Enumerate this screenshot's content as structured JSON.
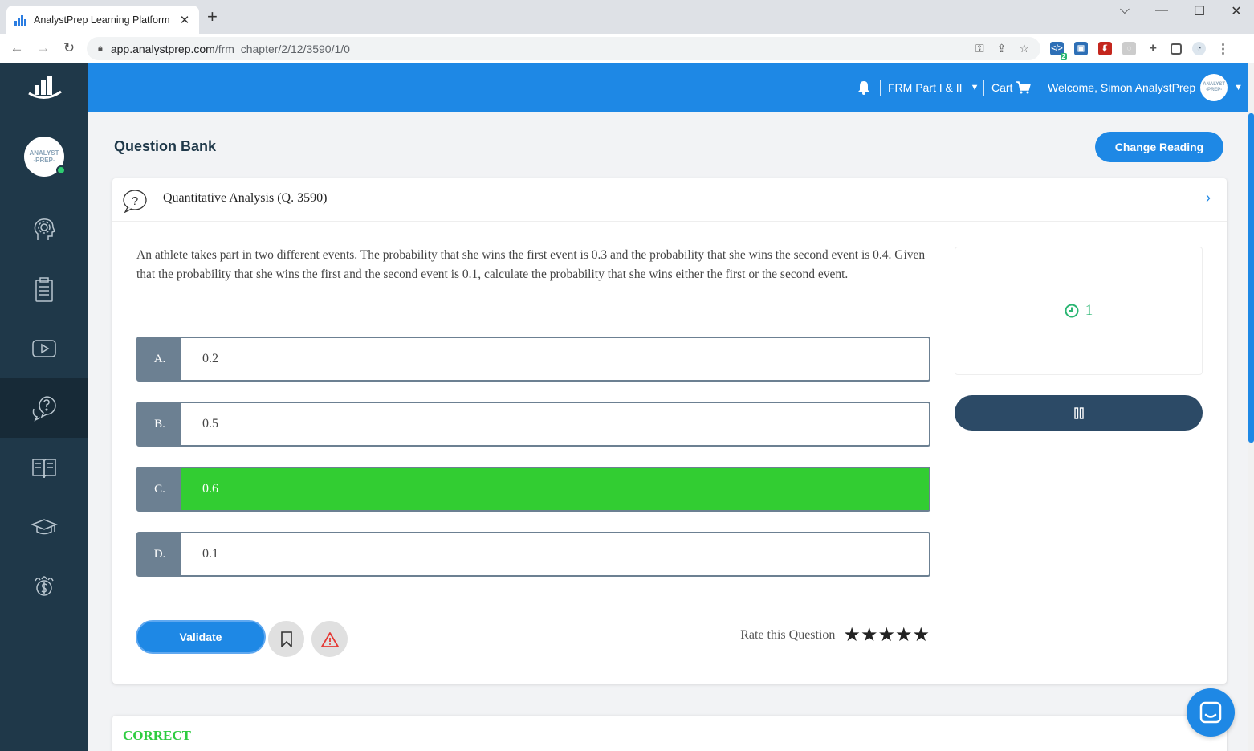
{
  "browser": {
    "tab_title": "AnalystPrep Learning Platform",
    "url_host": "app.analystprep.com",
    "url_path": "/frm_chapter/2/12/3590/1/0",
    "ext_badge": "2"
  },
  "header": {
    "course": "FRM Part I & II",
    "cart": "Cart",
    "welcome": "Welcome, Simon AnalystPrep",
    "avatar_line1": "ANALYST",
    "avatar_line2": "-PREP-"
  },
  "sidebar": {
    "avatar_line1": "ANALYST",
    "avatar_line2": "-PREP-",
    "items": [
      "settings",
      "notes",
      "videos",
      "question-bank",
      "reading",
      "courses",
      "finance"
    ],
    "active": "question-bank"
  },
  "page": {
    "title": "Question Bank",
    "change_reading": "Change Reading"
  },
  "question": {
    "title": "Quantitative Analysis (Q. 3590)",
    "text": "An athlete takes part in two different events. The probability that she wins the first event is 0.3 and the probability that she wins the second event is 0.4. Given that the probability that she wins the first and the second event is 0.1, calculate the probability that she wins either the first or the second event.",
    "options": [
      {
        "letter": "A.",
        "value": "0.2"
      },
      {
        "letter": "B.",
        "value": "0.5"
      },
      {
        "letter": "C.",
        "value": "0.6"
      },
      {
        "letter": "D.",
        "value": "0.1"
      }
    ],
    "correct_index": 2,
    "validate_label": "Validate",
    "rate_label": "Rate this Question",
    "rating_stars": "★★★★★",
    "timer_value": "1",
    "result": "CORRECT"
  },
  "colors": {
    "brand_blue": "#1e88e5",
    "sidebar": "#1f3849",
    "correct_green": "#32cd32",
    "timer_green": "#2bb673"
  }
}
